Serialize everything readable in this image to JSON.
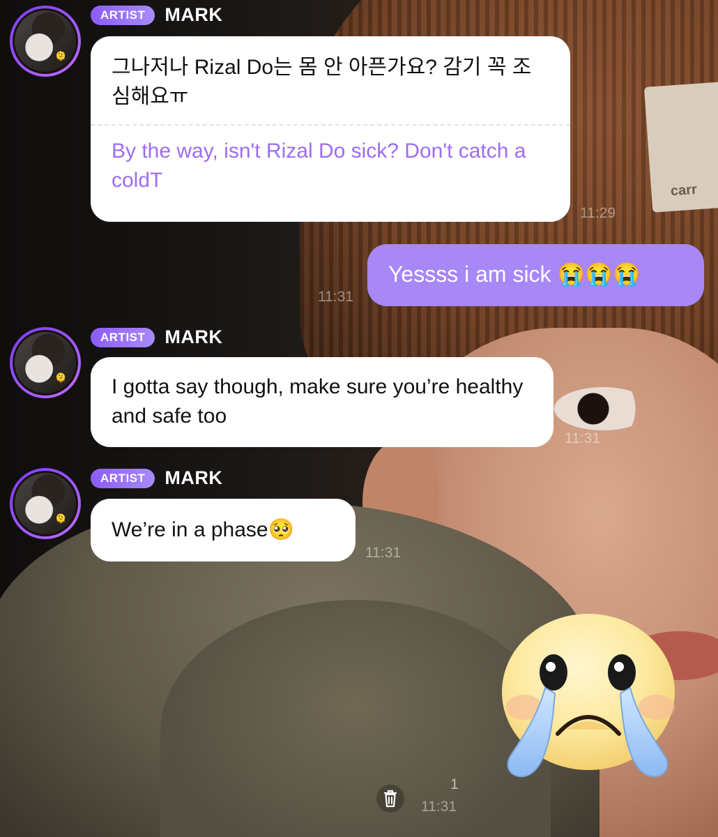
{
  "messages": {
    "m1": {
      "badge": "ARTIST",
      "sender": "MARK",
      "original": "그나저나 Rizal Do는 몸 안 아픈가요? 감기 꼭 조심해요ㅠ",
      "translation": "By the way, isn't Rizal Do sick? Don't catch a coldT",
      "time": "11:29"
    },
    "m2": {
      "text": "Yessss i am sick 😭😭😭",
      "time": "11:31"
    },
    "m3": {
      "badge": "ARTIST",
      "sender": "MARK",
      "text": "I gotta say though, make sure you’re healthy and safe too",
      "time": "11:31"
    },
    "m4": {
      "badge": "ARTIST",
      "sender": "MARK",
      "text": "We’re in a phase🥺",
      "time": "11:31"
    },
    "m5": {
      "unread": "1",
      "time": "11:31",
      "sticker": "crying-face-sticker"
    }
  },
  "icons": {
    "trash": "trash-icon"
  },
  "colors": {
    "accent": "#a887f7",
    "translation": "#9d6df0",
    "badge": "#8b5cf6"
  }
}
